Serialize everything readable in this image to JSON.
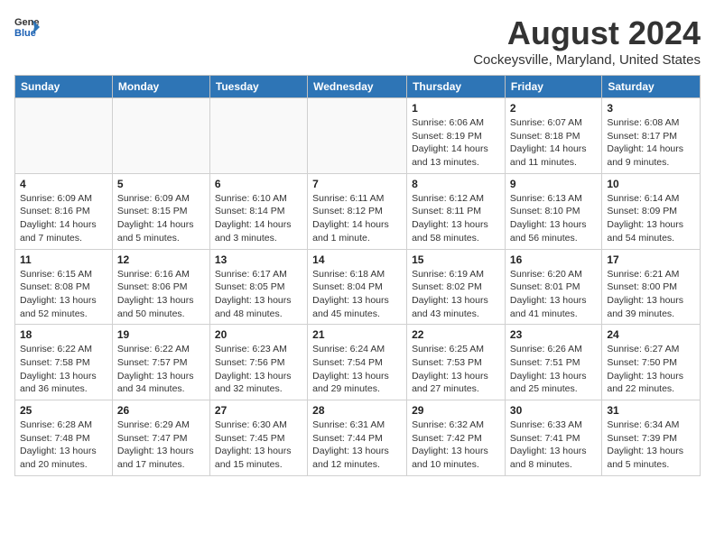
{
  "header": {
    "logo_line1": "General",
    "logo_line2": "Blue",
    "month_year": "August 2024",
    "location": "Cockeysville, Maryland, United States"
  },
  "weekdays": [
    "Sunday",
    "Monday",
    "Tuesday",
    "Wednesday",
    "Thursday",
    "Friday",
    "Saturday"
  ],
  "weeks": [
    [
      {
        "day": "",
        "info": ""
      },
      {
        "day": "",
        "info": ""
      },
      {
        "day": "",
        "info": ""
      },
      {
        "day": "",
        "info": ""
      },
      {
        "day": "1",
        "info": "Sunrise: 6:06 AM\nSunset: 8:19 PM\nDaylight: 14 hours\nand 13 minutes."
      },
      {
        "day": "2",
        "info": "Sunrise: 6:07 AM\nSunset: 8:18 PM\nDaylight: 14 hours\nand 11 minutes."
      },
      {
        "day": "3",
        "info": "Sunrise: 6:08 AM\nSunset: 8:17 PM\nDaylight: 14 hours\nand 9 minutes."
      }
    ],
    [
      {
        "day": "4",
        "info": "Sunrise: 6:09 AM\nSunset: 8:16 PM\nDaylight: 14 hours\nand 7 minutes."
      },
      {
        "day": "5",
        "info": "Sunrise: 6:09 AM\nSunset: 8:15 PM\nDaylight: 14 hours\nand 5 minutes."
      },
      {
        "day": "6",
        "info": "Sunrise: 6:10 AM\nSunset: 8:14 PM\nDaylight: 14 hours\nand 3 minutes."
      },
      {
        "day": "7",
        "info": "Sunrise: 6:11 AM\nSunset: 8:12 PM\nDaylight: 14 hours\nand 1 minute."
      },
      {
        "day": "8",
        "info": "Sunrise: 6:12 AM\nSunset: 8:11 PM\nDaylight: 13 hours\nand 58 minutes."
      },
      {
        "day": "9",
        "info": "Sunrise: 6:13 AM\nSunset: 8:10 PM\nDaylight: 13 hours\nand 56 minutes."
      },
      {
        "day": "10",
        "info": "Sunrise: 6:14 AM\nSunset: 8:09 PM\nDaylight: 13 hours\nand 54 minutes."
      }
    ],
    [
      {
        "day": "11",
        "info": "Sunrise: 6:15 AM\nSunset: 8:08 PM\nDaylight: 13 hours\nand 52 minutes."
      },
      {
        "day": "12",
        "info": "Sunrise: 6:16 AM\nSunset: 8:06 PM\nDaylight: 13 hours\nand 50 minutes."
      },
      {
        "day": "13",
        "info": "Sunrise: 6:17 AM\nSunset: 8:05 PM\nDaylight: 13 hours\nand 48 minutes."
      },
      {
        "day": "14",
        "info": "Sunrise: 6:18 AM\nSunset: 8:04 PM\nDaylight: 13 hours\nand 45 minutes."
      },
      {
        "day": "15",
        "info": "Sunrise: 6:19 AM\nSunset: 8:02 PM\nDaylight: 13 hours\nand 43 minutes."
      },
      {
        "day": "16",
        "info": "Sunrise: 6:20 AM\nSunset: 8:01 PM\nDaylight: 13 hours\nand 41 minutes."
      },
      {
        "day": "17",
        "info": "Sunrise: 6:21 AM\nSunset: 8:00 PM\nDaylight: 13 hours\nand 39 minutes."
      }
    ],
    [
      {
        "day": "18",
        "info": "Sunrise: 6:22 AM\nSunset: 7:58 PM\nDaylight: 13 hours\nand 36 minutes."
      },
      {
        "day": "19",
        "info": "Sunrise: 6:22 AM\nSunset: 7:57 PM\nDaylight: 13 hours\nand 34 minutes."
      },
      {
        "day": "20",
        "info": "Sunrise: 6:23 AM\nSunset: 7:56 PM\nDaylight: 13 hours\nand 32 minutes."
      },
      {
        "day": "21",
        "info": "Sunrise: 6:24 AM\nSunset: 7:54 PM\nDaylight: 13 hours\nand 29 minutes."
      },
      {
        "day": "22",
        "info": "Sunrise: 6:25 AM\nSunset: 7:53 PM\nDaylight: 13 hours\nand 27 minutes."
      },
      {
        "day": "23",
        "info": "Sunrise: 6:26 AM\nSunset: 7:51 PM\nDaylight: 13 hours\nand 25 minutes."
      },
      {
        "day": "24",
        "info": "Sunrise: 6:27 AM\nSunset: 7:50 PM\nDaylight: 13 hours\nand 22 minutes."
      }
    ],
    [
      {
        "day": "25",
        "info": "Sunrise: 6:28 AM\nSunset: 7:48 PM\nDaylight: 13 hours\nand 20 minutes."
      },
      {
        "day": "26",
        "info": "Sunrise: 6:29 AM\nSunset: 7:47 PM\nDaylight: 13 hours\nand 17 minutes."
      },
      {
        "day": "27",
        "info": "Sunrise: 6:30 AM\nSunset: 7:45 PM\nDaylight: 13 hours\nand 15 minutes."
      },
      {
        "day": "28",
        "info": "Sunrise: 6:31 AM\nSunset: 7:44 PM\nDaylight: 13 hours\nand 12 minutes."
      },
      {
        "day": "29",
        "info": "Sunrise: 6:32 AM\nSunset: 7:42 PM\nDaylight: 13 hours\nand 10 minutes."
      },
      {
        "day": "30",
        "info": "Sunrise: 6:33 AM\nSunset: 7:41 PM\nDaylight: 13 hours\nand 8 minutes."
      },
      {
        "day": "31",
        "info": "Sunrise: 6:34 AM\nSunset: 7:39 PM\nDaylight: 13 hours\nand 5 minutes."
      }
    ]
  ]
}
